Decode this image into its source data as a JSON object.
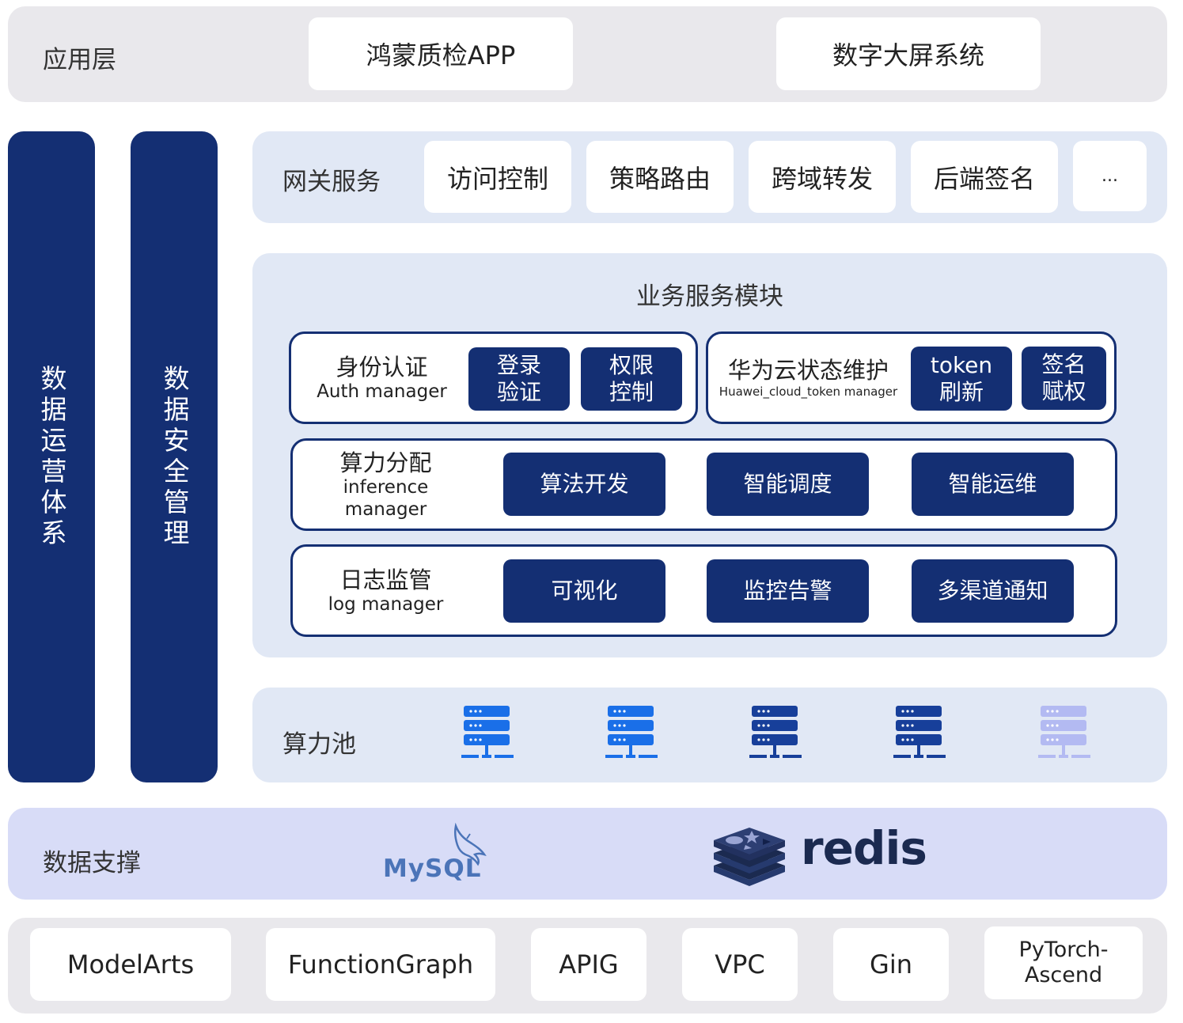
{
  "application_layer": {
    "label": "应用层",
    "apps": [
      "鸿蒙质检APP",
      "数字大屏系统"
    ]
  },
  "side_bars": [
    "数据运营体系",
    "数据安全管理"
  ],
  "gateway": {
    "label": "网关服务",
    "items": [
      "访问控制",
      "策略路由",
      "跨域转发",
      "后端签名",
      "..."
    ]
  },
  "business": {
    "title": "业务服务模块",
    "auth": {
      "cn": "身份认证",
      "en": "Auth manager",
      "buttons": [
        [
          "登录",
          "验证"
        ],
        [
          "权限",
          "控制"
        ]
      ]
    },
    "huawei": {
      "cn": "华为云状态维护",
      "en": "Huawei_cloud_token manager",
      "buttons": [
        [
          "token",
          "刷新"
        ],
        [
          "签名",
          "赋权"
        ]
      ]
    },
    "inference": {
      "cn": "算力分配",
      "en": "inference manager",
      "buttons": [
        "算法开发",
        "智能调度",
        "智能运维"
      ]
    },
    "log": {
      "cn": "日志监管",
      "en": "log manager",
      "buttons": [
        "可视化",
        "监控告警",
        "多渠道通知"
      ]
    }
  },
  "compute_pool": {
    "label": "算力池",
    "servers": [
      {
        "icon": "server-icon",
        "color": "#1a6fe8"
      },
      {
        "icon": "server-icon",
        "color": "#1a6fe8"
      },
      {
        "icon": "server-icon",
        "color": "#173f9a"
      },
      {
        "icon": "server-icon",
        "color": "#173f9a"
      },
      {
        "icon": "server-icon",
        "color": "#b3baf2"
      }
    ]
  },
  "data_support": {
    "label": "数据支撑",
    "mysql_logo": "MySQL",
    "redis_logo": "redis"
  },
  "infrastructure": [
    "ModelArts",
    "FunctionGraph",
    "APIG",
    "VPC",
    "Gin",
    [
      "PyTorch-",
      "Ascend"
    ]
  ],
  "colors": {
    "navy": "#142f73",
    "light_band": "#e1e8f5",
    "gray_band": "#e9e8ec",
    "purple_band": "#d8dcf7"
  }
}
